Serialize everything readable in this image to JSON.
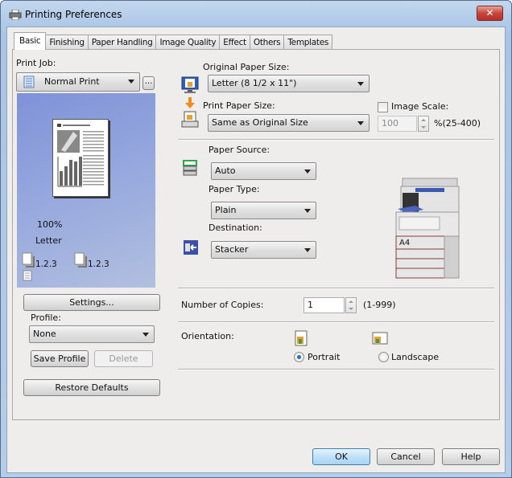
{
  "window": {
    "title": "Printing Preferences",
    "close_label": "✕"
  },
  "tabs": [
    {
      "label": "Basic",
      "active": true
    },
    {
      "label": "Finishing"
    },
    {
      "label": "Paper Handling"
    },
    {
      "label": "Image Quality"
    },
    {
      "label": "Effect"
    },
    {
      "label": "Others"
    },
    {
      "label": "Templates"
    }
  ],
  "left": {
    "print_job_label": "Print Job:",
    "print_job_value": "Normal Print",
    "ellipsis_label": "...",
    "preview": {
      "zoom_text": "100%",
      "paper_text": "Letter",
      "collate_1": "1.2.3",
      "collate_2": "1.2.3"
    },
    "settings_label": "Settings...",
    "profile_label": "Profile:",
    "profile_value": "None",
    "save_profile_label": "Save Profile",
    "delete_label": "Delete",
    "restore_defaults_label": "Restore Defaults"
  },
  "right": {
    "original_paper_size_label": "Original Paper Size:",
    "original_paper_size_value": "Letter (8 1/2 x 11\")",
    "print_paper_size_label": "Print Paper Size:",
    "print_paper_size_value": "Same as Original Size",
    "image_scale_label": "Image Scale:",
    "image_scale_checked": false,
    "image_scale_value": "100",
    "image_scale_range": "%(25-400)",
    "paper_source_label": "Paper Source:",
    "paper_source_value": "Auto",
    "paper_type_label": "Paper Type:",
    "paper_type_value": "Plain",
    "destination_label": "Destination:",
    "destination_value": "Stacker",
    "printer_tray_label": "A4",
    "copies_label": "Number of Copies:",
    "copies_value": "1",
    "copies_range": "(1-999)",
    "orientation_label": "Orientation:",
    "portrait_label": "Portrait",
    "landscape_label": "Landscape",
    "orientation_selected": "Portrait"
  },
  "footer": {
    "ok_label": "OK",
    "cancel_label": "Cancel",
    "help_label": "Help"
  },
  "colors": {
    "accent": "#2a6fb8",
    "close_red": "#c7453a",
    "preview_blue": "#8b9ddb"
  }
}
